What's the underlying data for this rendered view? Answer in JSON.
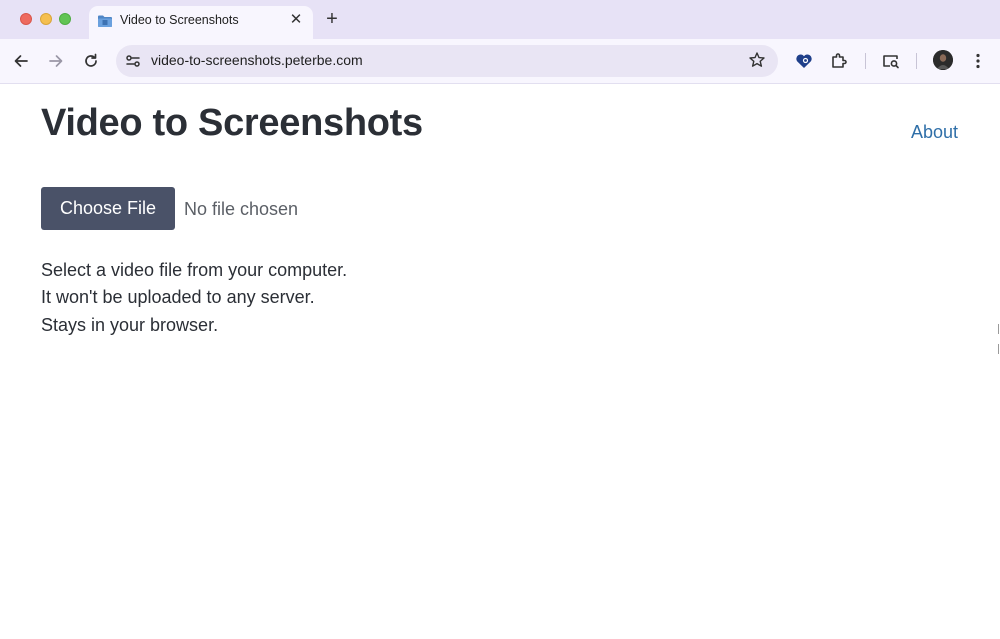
{
  "browser": {
    "tab": {
      "title": "Video to Screenshots",
      "close_glyph": "✕",
      "favicon": "folder-icon"
    },
    "new_tab_glyph": "+",
    "address_bar": {
      "url": "video-to-screenshots.peterbe.com"
    }
  },
  "page": {
    "title": "Video to Screenshots",
    "about_link": "About",
    "file_input": {
      "button_label": "Choose File",
      "status": "No file chosen"
    },
    "description": [
      "Select a video file from your computer.",
      "It won't be uploaded to any server.",
      "Stays in your browser."
    ]
  },
  "colors": {
    "tabstrip_bg": "#e7e2f6",
    "toolbar_bg": "#f8f6fe",
    "button_bg": "#4a5268",
    "link": "#2f6fa8",
    "heading": "#2b2f36"
  }
}
